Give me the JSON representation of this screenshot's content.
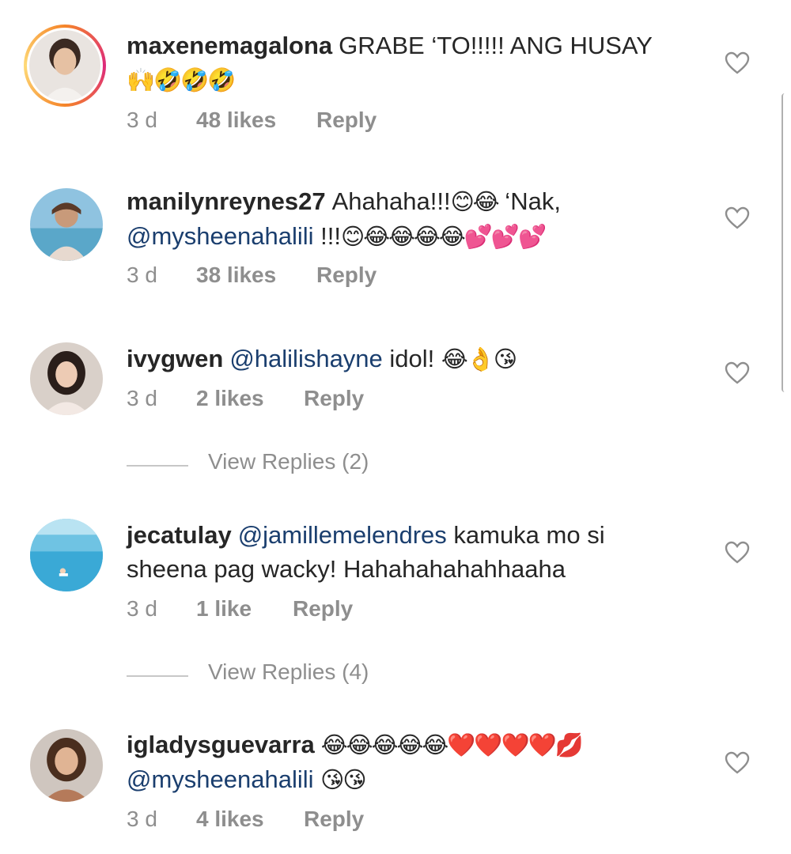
{
  "comments": [
    {
      "username": "maxenemagalona",
      "text": "GRABE ‘TO!!!!! ANG HUSAY",
      "emojis": "🙌🤣🤣🤣",
      "time": "3 d",
      "likes": "48 likes",
      "reply": "Reply"
    },
    {
      "username": "manilynreynes27",
      "text": "Ahahaha!!!",
      "emojis1": "😊😂",
      "text2": " ‘Nak,",
      "mention": "@mysheenahalili",
      "text3": " !!!",
      "emojis2": "😊😂😂😂😂💕💕💕",
      "time": "3 d",
      "likes": "38 likes",
      "reply": "Reply"
    },
    {
      "username": "ivygwen",
      "mention": "@halilishayne",
      "text": " idol!",
      "emojis": "😂👌😘",
      "time": "3 d",
      "likes": "2 likes",
      "reply": "Reply",
      "view_replies": "View Replies (2)"
    },
    {
      "username": "jecatulay",
      "mention": "@jamillemelendres",
      "text": " kamuka mo si",
      "text2": "sheena pag wacky! Hahahahahahhaaha",
      "time": "3 d",
      "likes": "1 like",
      "reply": "Reply",
      "view_replies": "View Replies (4)"
    },
    {
      "username": "igladysguevarra",
      "emojis1": "😂😂😂😂😂❤️❤️❤️❤️💋",
      "mention": "@mysheenahalili",
      "emojis2": "😘😘",
      "time": "3 d",
      "likes": "4 likes",
      "reply": "Reply"
    }
  ],
  "colors": {
    "text": "#262626",
    "meta": "#8e8e8e",
    "mention": "#1a3e6e",
    "story_ring": "#dd2a7b"
  }
}
